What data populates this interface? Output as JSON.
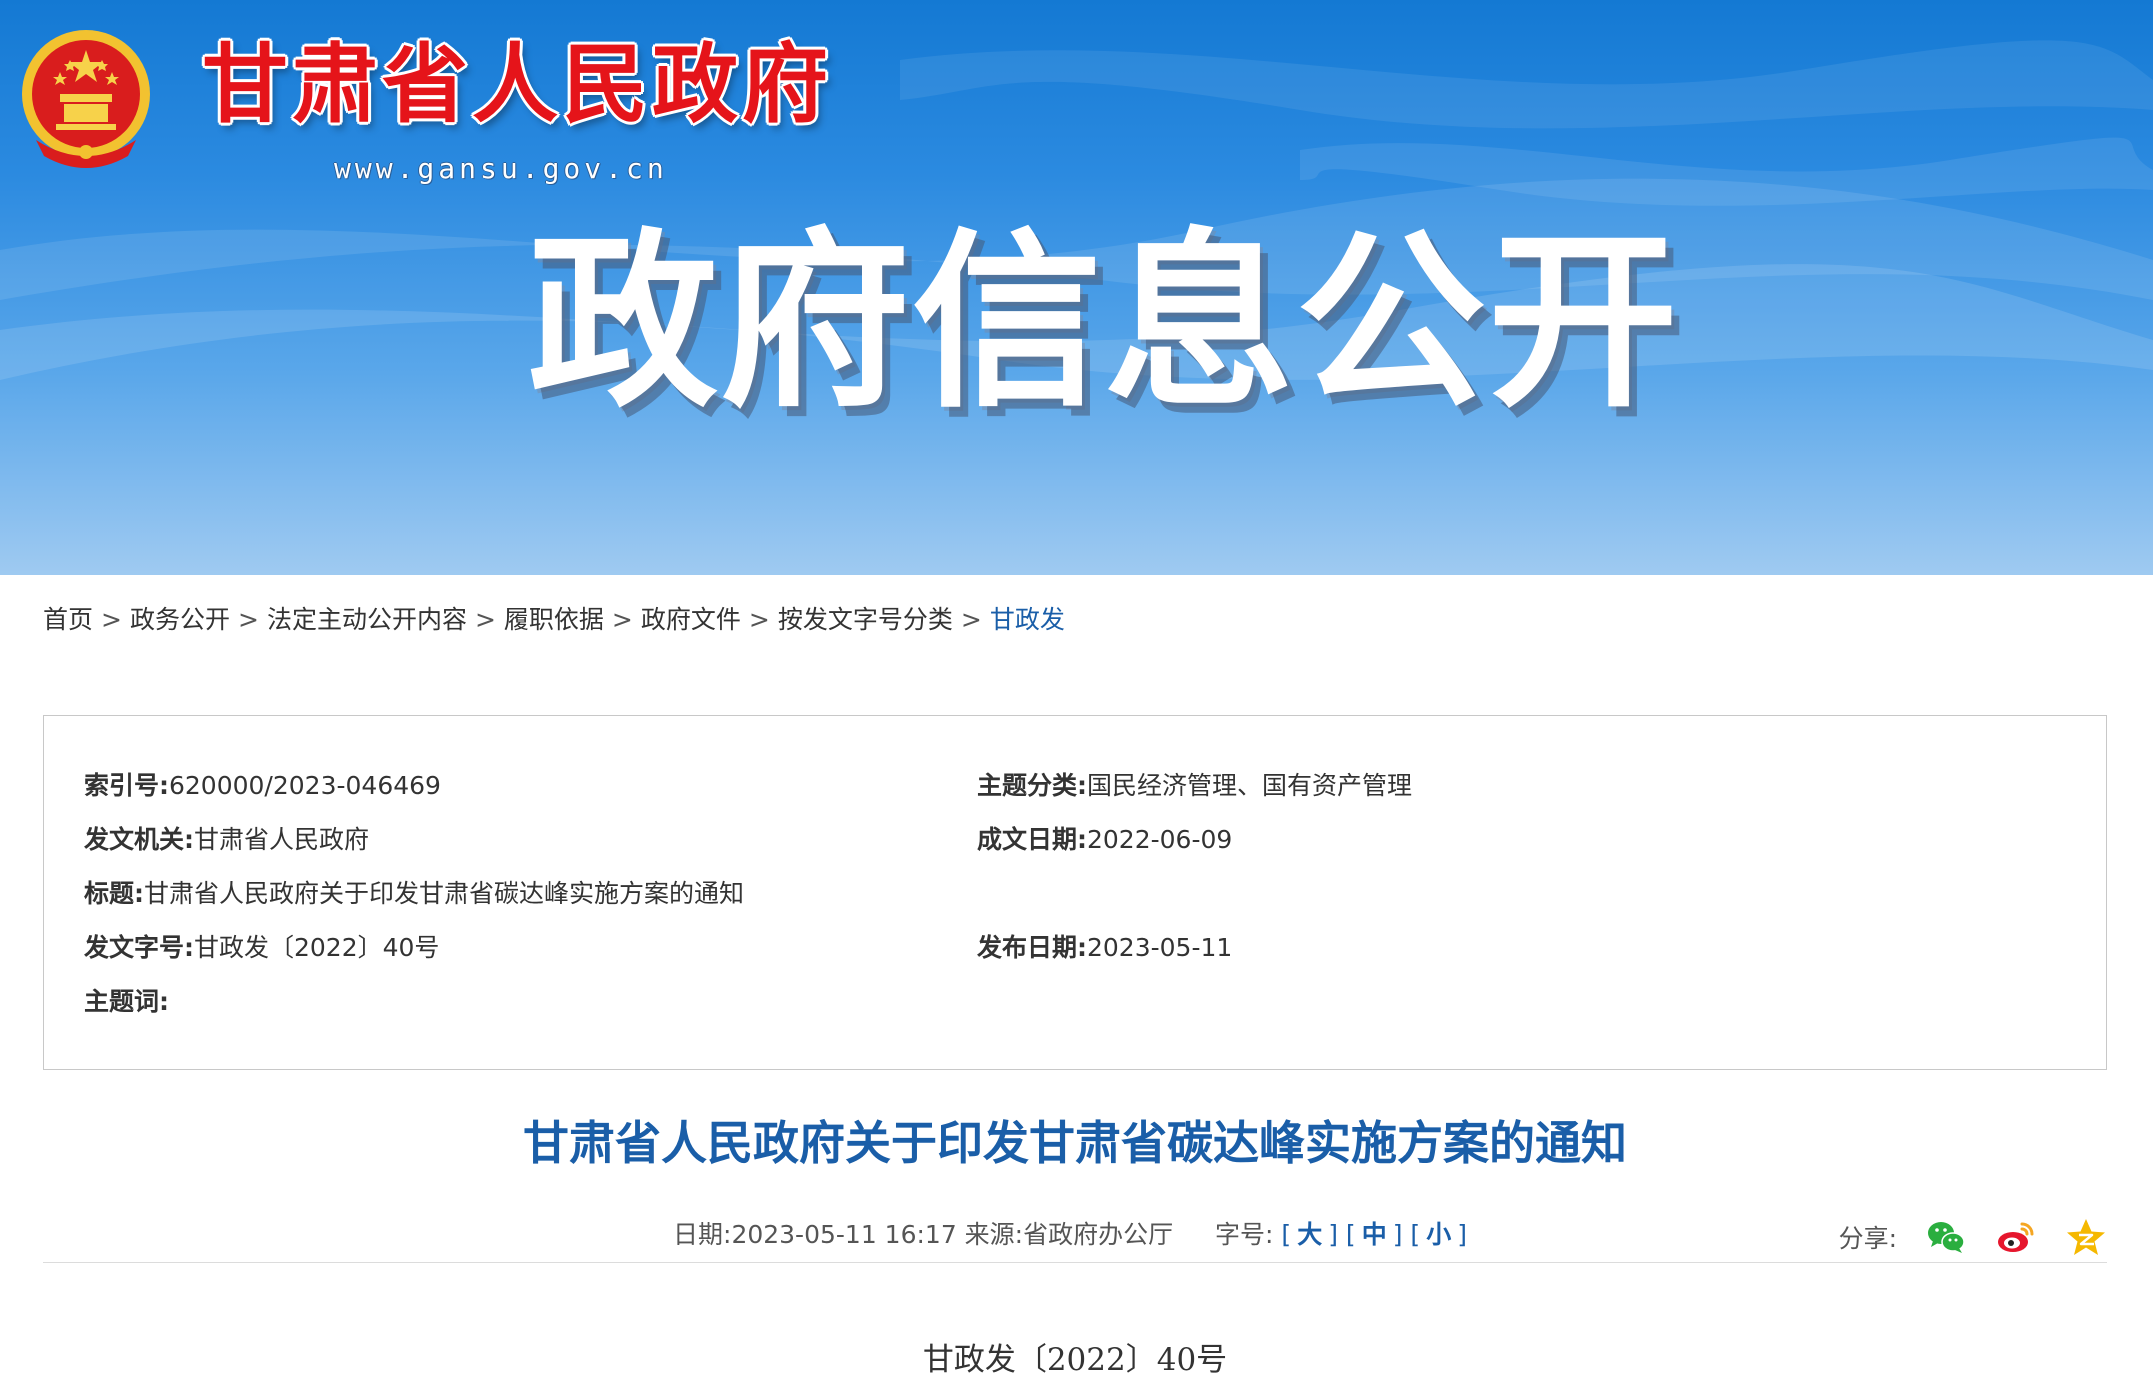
{
  "banner": {
    "site_name": "甘肃省人民政府",
    "site_url": "www.gansu.gov.cn",
    "title": "政府信息公开"
  },
  "breadcrumb": {
    "items": [
      "首页",
      "政务公开",
      "法定主动公开内容",
      "履职依据",
      "政府文件",
      "按发文字号分类",
      "甘政发"
    ],
    "separator": ">"
  },
  "info": {
    "index_no": {
      "label": "索引号:",
      "value": "620000/2023-046469"
    },
    "topic_category": {
      "label": "主题分类:",
      "value": "国民经济管理、国有资产管理"
    },
    "issuing_org": {
      "label": "发文机关:",
      "value": "甘肃省人民政府"
    },
    "written_date": {
      "label": "成文日期:",
      "value": "2022-06-09"
    },
    "title": {
      "label": "标题:",
      "value": "甘肃省人民政府关于印发甘肃省碳达峰实施方案的通知"
    },
    "doc_number": {
      "label": "发文字号:",
      "value": "甘政发〔2022〕40号"
    },
    "publish_date": {
      "label": "发布日期:",
      "value": "2023-05-11"
    },
    "keywords": {
      "label": "主题词:",
      "value": ""
    }
  },
  "article": {
    "title": "甘肃省人民政府关于印发甘肃省碳达峰实施方案的通知",
    "date_label": "日期:",
    "date_value": "2023-05-11 16:17",
    "source_label": "来源:",
    "source_value": "省政府办公厅",
    "font_size_label": "字号:",
    "font_large": "大",
    "font_medium": "中",
    "font_small": "小",
    "share_label": "分享:",
    "doc_number": "甘政发〔2022〕40号"
  },
  "colors": {
    "site_red": "#e5141a",
    "link_blue": "#1a5ea8",
    "banner_blue": "#1479d3",
    "wechat_green": "#2aae3f",
    "weibo_red": "#e6162d",
    "qzone_yellow": "#f5b800"
  },
  "icons": {
    "emblem": "national-emblem-icon",
    "wechat": "wechat-icon",
    "weibo": "weibo-icon",
    "qzone": "qzone-star-icon"
  }
}
